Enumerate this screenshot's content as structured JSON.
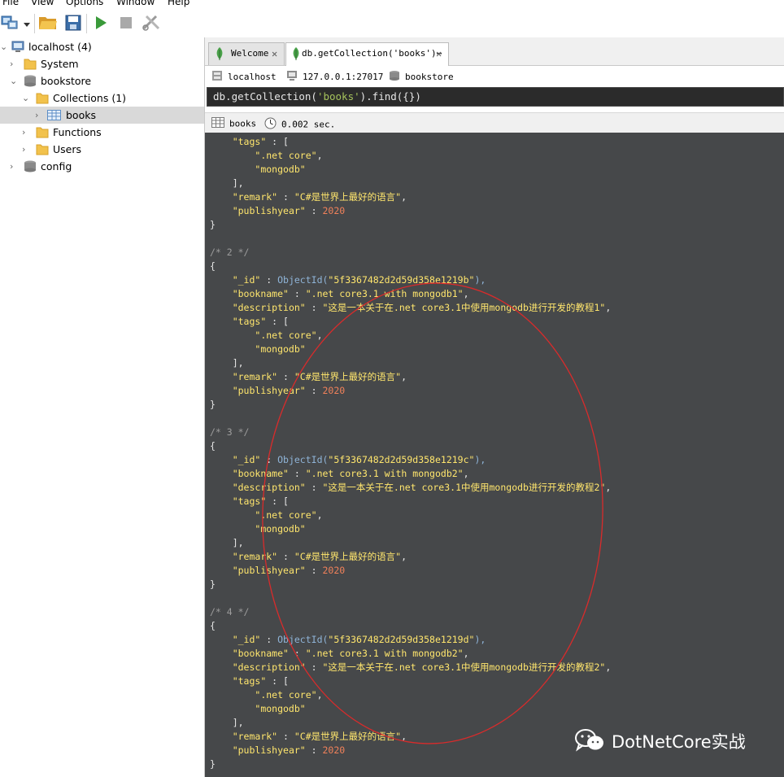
{
  "menu": [
    "File",
    "View",
    "Options",
    "Window",
    "Help"
  ],
  "tree": {
    "server": "localhost (4)",
    "system": "System",
    "database": "bookstore",
    "collections": "Collections (1)",
    "collection": "books",
    "functions": "Functions",
    "users": "Users",
    "config": "config"
  },
  "tabs": [
    {
      "label": "Welcome"
    },
    {
      "label": "db.getCollection('books')⋯"
    }
  ],
  "info": {
    "host": "localhost",
    "address": "127.0.0.1:27017",
    "db": "bookstore"
  },
  "query": {
    "prefix": "db.getCollection(",
    "arg": "'books'",
    "suffix": ").find({})"
  },
  "status": {
    "collection": "books",
    "time": "0.002 sec."
  },
  "lines": [
    [
      {
        "t": "    "
      },
      {
        "t": "\"tags\"",
        "c": "k"
      },
      {
        "t": " : ["
      }
    ],
    [
      {
        "t": "        "
      },
      {
        "t": "\".net core\"",
        "c": "s"
      },
      {
        "t": ","
      }
    ],
    [
      {
        "t": "        "
      },
      {
        "t": "\"mongodb\"",
        "c": "s"
      }
    ],
    [
      {
        "t": "    ],"
      }
    ],
    [
      {
        "t": "    "
      },
      {
        "t": "\"remark\"",
        "c": "k"
      },
      {
        "t": " : "
      },
      {
        "t": "\"C#是世界上最好的语言\"",
        "c": "s"
      },
      {
        "t": ","
      }
    ],
    [
      {
        "t": "    "
      },
      {
        "t": "\"publishyear\"",
        "c": "k"
      },
      {
        "t": " : "
      },
      {
        "t": "2020",
        "c": "n"
      }
    ],
    [
      {
        "t": "}"
      }
    ],
    [
      {
        "t": ""
      }
    ],
    [
      {
        "t": "/* 2 */",
        "c": "c"
      }
    ],
    [
      {
        "t": "{"
      }
    ],
    [
      {
        "t": "    "
      },
      {
        "t": "\"_id\"",
        "c": "k"
      },
      {
        "t": " : "
      },
      {
        "t": "ObjectId(",
        "c": "oid"
      },
      {
        "t": "\"5f3367482d2d59d358e1219b\"",
        "c": "s"
      },
      {
        "t": "),",
        "c": "oid"
      }
    ],
    [
      {
        "t": "    "
      },
      {
        "t": "\"bookname\"",
        "c": "k"
      },
      {
        "t": " : "
      },
      {
        "t": "\".net core3.1 with mongodb1\"",
        "c": "s"
      },
      {
        "t": ","
      }
    ],
    [
      {
        "t": "    "
      },
      {
        "t": "\"description\"",
        "c": "k"
      },
      {
        "t": " : "
      },
      {
        "t": "\"这是一本关于在.net core3.1中使用mongodb进行开发的教程1\"",
        "c": "s"
      },
      {
        "t": ","
      }
    ],
    [
      {
        "t": "    "
      },
      {
        "t": "\"tags\"",
        "c": "k"
      },
      {
        "t": " : ["
      }
    ],
    [
      {
        "t": "        "
      },
      {
        "t": "\".net core\"",
        "c": "s"
      },
      {
        "t": ","
      }
    ],
    [
      {
        "t": "        "
      },
      {
        "t": "\"mongodb\"",
        "c": "s"
      }
    ],
    [
      {
        "t": "    ],"
      }
    ],
    [
      {
        "t": "    "
      },
      {
        "t": "\"remark\"",
        "c": "k"
      },
      {
        "t": " : "
      },
      {
        "t": "\"C#是世界上最好的语言\"",
        "c": "s"
      },
      {
        "t": ","
      }
    ],
    [
      {
        "t": "    "
      },
      {
        "t": "\"publishyear\"",
        "c": "k"
      },
      {
        "t": " : "
      },
      {
        "t": "2020",
        "c": "n"
      }
    ],
    [
      {
        "t": "}"
      }
    ],
    [
      {
        "t": ""
      }
    ],
    [
      {
        "t": "/* 3 */",
        "c": "c"
      }
    ],
    [
      {
        "t": "{"
      }
    ],
    [
      {
        "t": "    "
      },
      {
        "t": "\"_id\"",
        "c": "k"
      },
      {
        "t": " : "
      },
      {
        "t": "ObjectId(",
        "c": "oid"
      },
      {
        "t": "\"5f3367482d2d59d358e1219c\"",
        "c": "s"
      },
      {
        "t": "),",
        "c": "oid"
      }
    ],
    [
      {
        "t": "    "
      },
      {
        "t": "\"bookname\"",
        "c": "k"
      },
      {
        "t": " : "
      },
      {
        "t": "\".net core3.1 with mongodb2\"",
        "c": "s"
      },
      {
        "t": ","
      }
    ],
    [
      {
        "t": "    "
      },
      {
        "t": "\"description\"",
        "c": "k"
      },
      {
        "t": " : "
      },
      {
        "t": "\"这是一本关于在.net core3.1中使用mongodb进行开发的教程2\"",
        "c": "s"
      },
      {
        "t": ","
      }
    ],
    [
      {
        "t": "    "
      },
      {
        "t": "\"tags\"",
        "c": "k"
      },
      {
        "t": " : ["
      }
    ],
    [
      {
        "t": "        "
      },
      {
        "t": "\".net core\"",
        "c": "s"
      },
      {
        "t": ","
      }
    ],
    [
      {
        "t": "        "
      },
      {
        "t": "\"mongodb\"",
        "c": "s"
      }
    ],
    [
      {
        "t": "    ],"
      }
    ],
    [
      {
        "t": "    "
      },
      {
        "t": "\"remark\"",
        "c": "k"
      },
      {
        "t": " : "
      },
      {
        "t": "\"C#是世界上最好的语言\"",
        "c": "s"
      },
      {
        "t": ","
      }
    ],
    [
      {
        "t": "    "
      },
      {
        "t": "\"publishyear\"",
        "c": "k"
      },
      {
        "t": " : "
      },
      {
        "t": "2020",
        "c": "n"
      }
    ],
    [
      {
        "t": "}"
      }
    ],
    [
      {
        "t": ""
      }
    ],
    [
      {
        "t": "/* 4 */",
        "c": "c"
      }
    ],
    [
      {
        "t": "{"
      }
    ],
    [
      {
        "t": "    "
      },
      {
        "t": "\"_id\"",
        "c": "k"
      },
      {
        "t": " : "
      },
      {
        "t": "ObjectId(",
        "c": "oid"
      },
      {
        "t": "\"5f3367482d2d59d358e1219d\"",
        "c": "s"
      },
      {
        "t": "),",
        "c": "oid"
      }
    ],
    [
      {
        "t": "    "
      },
      {
        "t": "\"bookname\"",
        "c": "k"
      },
      {
        "t": " : "
      },
      {
        "t": "\".net core3.1 with mongodb2\"",
        "c": "s"
      },
      {
        "t": ","
      }
    ],
    [
      {
        "t": "    "
      },
      {
        "t": "\"description\"",
        "c": "k"
      },
      {
        "t": " : "
      },
      {
        "t": "\"这是一本关于在.net core3.1中使用mongodb进行开发的教程2\"",
        "c": "s"
      },
      {
        "t": ","
      }
    ],
    [
      {
        "t": "    "
      },
      {
        "t": "\"tags\"",
        "c": "k"
      },
      {
        "t": " : ["
      }
    ],
    [
      {
        "t": "        "
      },
      {
        "t": "\".net core\"",
        "c": "s"
      },
      {
        "t": ","
      }
    ],
    [
      {
        "t": "        "
      },
      {
        "t": "\"mongodb\"",
        "c": "s"
      }
    ],
    [
      {
        "t": "    ],"
      }
    ],
    [
      {
        "t": "    "
      },
      {
        "t": "\"remark\"",
        "c": "k"
      },
      {
        "t": " : "
      },
      {
        "t": "\"C#是世界上最好的语言\"",
        "c": "s"
      },
      {
        "t": ","
      }
    ],
    [
      {
        "t": "    "
      },
      {
        "t": "\"publishyear\"",
        "c": "k"
      },
      {
        "t": " : "
      },
      {
        "t": "2020",
        "c": "n"
      }
    ],
    [
      {
        "t": "}"
      }
    ]
  ],
  "watermark": "DotNetCore实战",
  "colors": {
    "key": "#ffe66d",
    "number": "#f0815a",
    "comment": "#9c9c9c",
    "objectid": "#8fb4d8",
    "background": "#46484a",
    "annotation": "#d92b2b"
  }
}
